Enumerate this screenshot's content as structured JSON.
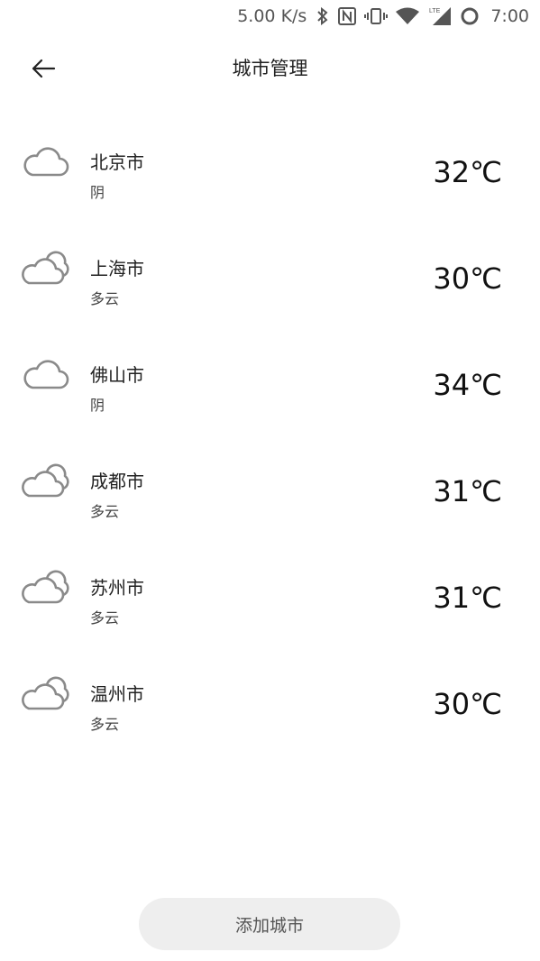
{
  "status_bar": {
    "speed": "5.00 K/s",
    "time": "7:00",
    "icons": [
      "bluetooth-icon",
      "nfc-icon",
      "vibrate-icon",
      "wifi-icon",
      "lte-signal-icon",
      "circle-status-icon"
    ]
  },
  "header": {
    "title": "城市管理",
    "back_icon": "arrow-left-icon"
  },
  "cities": [
    {
      "name": "北京市",
      "weather": "阴",
      "temp": "32℃",
      "icon": "cloud-overcast-icon"
    },
    {
      "name": "上海市",
      "weather": "多云",
      "temp": "30℃",
      "icon": "cloud-partly-icon"
    },
    {
      "name": "佛山市",
      "weather": "阴",
      "temp": "34℃",
      "icon": "cloud-overcast-icon"
    },
    {
      "name": "成都市",
      "weather": "多云",
      "temp": "31℃",
      "icon": "cloud-partly-icon"
    },
    {
      "name": "苏州市",
      "weather": "多云",
      "temp": "31℃",
      "icon": "cloud-partly-icon"
    },
    {
      "name": "温州市",
      "weather": "多云",
      "temp": "30℃",
      "icon": "cloud-partly-icon"
    }
  ],
  "add_button": {
    "label": "添加城市"
  },
  "colors": {
    "background": "#ffffff",
    "icon_stroke": "#8a8a8a",
    "button_bg": "#eeeeee",
    "status_text": "#555555"
  }
}
